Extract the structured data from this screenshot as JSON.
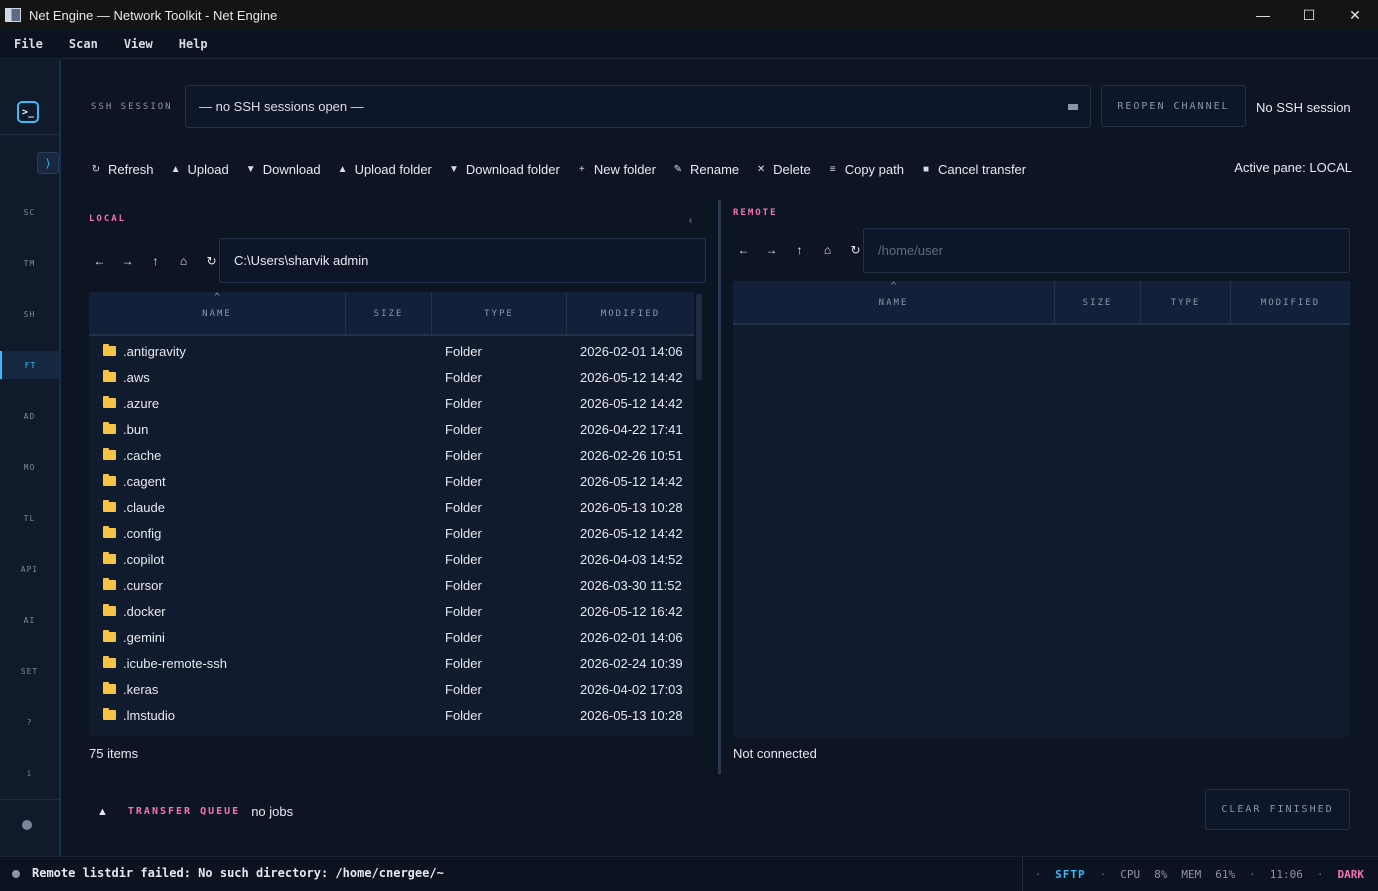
{
  "window": {
    "title": "Net Engine — Network Toolkit - Net Engine",
    "minimize": "—",
    "maximize": "☐",
    "close": "✕"
  },
  "menu": [
    "File",
    "Scan",
    "View",
    "Help"
  ],
  "sidebar": {
    "logo": ">_",
    "collapse": "⟩",
    "items": [
      "SC",
      "TM",
      "SH",
      "FT",
      "AD",
      "MO",
      "TL",
      "API",
      "AI",
      "SET",
      "?",
      "i"
    ],
    "active": "FT"
  },
  "ssh": {
    "label": "SSH SESSION",
    "selected": "— no SSH sessions open —",
    "reopen_label": "REOPEN CHANNEL",
    "status": "No SSH session"
  },
  "toolbar": {
    "buttons": [
      {
        "icon": "refresh-icon",
        "glyph": "↻",
        "label": "Refresh"
      },
      {
        "icon": "upload-icon",
        "glyph": "▲",
        "label": "Upload"
      },
      {
        "icon": "download-icon",
        "glyph": "▼",
        "label": "Download"
      },
      {
        "icon": "upload-folder-icon",
        "glyph": "▲",
        "label": "Upload folder"
      },
      {
        "icon": "download-folder-icon",
        "glyph": "▼",
        "label": "Download folder"
      },
      {
        "icon": "plus-icon",
        "glyph": "+",
        "label": "New folder"
      },
      {
        "icon": "rename-icon",
        "glyph": "✎",
        "label": "Rename"
      },
      {
        "icon": "delete-icon",
        "glyph": "✕",
        "label": "Delete"
      },
      {
        "icon": "copy-path-icon",
        "glyph": "≡",
        "label": "Copy path"
      },
      {
        "icon": "stop-icon",
        "glyph": "■",
        "label": "Cancel transfer"
      }
    ],
    "active_pane": "Active pane: LOCAL"
  },
  "local": {
    "title": "LOCAL",
    "collapse": "‹",
    "nav": [
      "←",
      "→",
      "↑",
      "⌂",
      "↻"
    ],
    "path": "C:\\Users\\sharvik admin",
    "columns": [
      "NAME",
      "SIZE",
      "TYPE",
      "MODIFIED"
    ],
    "sort_indicator": "^",
    "rows": [
      {
        "name": ".antigravity",
        "size": "",
        "type": "Folder",
        "modified": "2026-02-01 14:06"
      },
      {
        "name": ".aws",
        "size": "",
        "type": "Folder",
        "modified": "2026-05-12 14:42"
      },
      {
        "name": ".azure",
        "size": "",
        "type": "Folder",
        "modified": "2026-05-12 14:42"
      },
      {
        "name": ".bun",
        "size": "",
        "type": "Folder",
        "modified": "2026-04-22 17:41"
      },
      {
        "name": ".cache",
        "size": "",
        "type": "Folder",
        "modified": "2026-02-26 10:51"
      },
      {
        "name": ".cagent",
        "size": "",
        "type": "Folder",
        "modified": "2026-05-12 14:42"
      },
      {
        "name": ".claude",
        "size": "",
        "type": "Folder",
        "modified": "2026-05-13 10:28"
      },
      {
        "name": ".config",
        "size": "",
        "type": "Folder",
        "modified": "2026-05-12 14:42"
      },
      {
        "name": ".copilot",
        "size": "",
        "type": "Folder",
        "modified": "2026-04-03 14:52"
      },
      {
        "name": ".cursor",
        "size": "",
        "type": "Folder",
        "modified": "2026-03-30 11:52"
      },
      {
        "name": ".docker",
        "size": "",
        "type": "Folder",
        "modified": "2026-05-12 16:42"
      },
      {
        "name": ".gemini",
        "size": "",
        "type": "Folder",
        "modified": "2026-02-01 14:06"
      },
      {
        "name": ".icube-remote-ssh",
        "size": "",
        "type": "Folder",
        "modified": "2026-02-24 10:39"
      },
      {
        "name": ".keras",
        "size": "",
        "type": "Folder",
        "modified": "2026-04-02 17:03"
      },
      {
        "name": ".lmstudio",
        "size": "",
        "type": "Folder",
        "modified": "2026-05-13 10:28"
      }
    ],
    "count": "75 items"
  },
  "remote": {
    "title": "REMOTE",
    "nav": [
      "←",
      "→",
      "↑",
      "⌂",
      "↻"
    ],
    "path_placeholder": "/home/user",
    "columns": [
      "NAME",
      "SIZE",
      "TYPE",
      "MODIFIED"
    ],
    "sort_indicator": "^",
    "status": "Not connected"
  },
  "queue": {
    "caret": "▲",
    "label": "TRANSFER QUEUE",
    "value": "no jobs",
    "clear_label": "CLEAR FINISHED"
  },
  "statusbar": {
    "message": "Remote listdir failed: No such directory: /home/cnergee/~",
    "protocol": "SFTP",
    "cpu_label": "CPU",
    "cpu": "8%",
    "mem_label": "MEM",
    "mem": "61%",
    "time": "11:06",
    "theme": "DARK"
  },
  "colors": {
    "accent": "#38bdf8",
    "pink": "#f472b6",
    "folder": "#f6c344",
    "background": "#0d1524"
  }
}
